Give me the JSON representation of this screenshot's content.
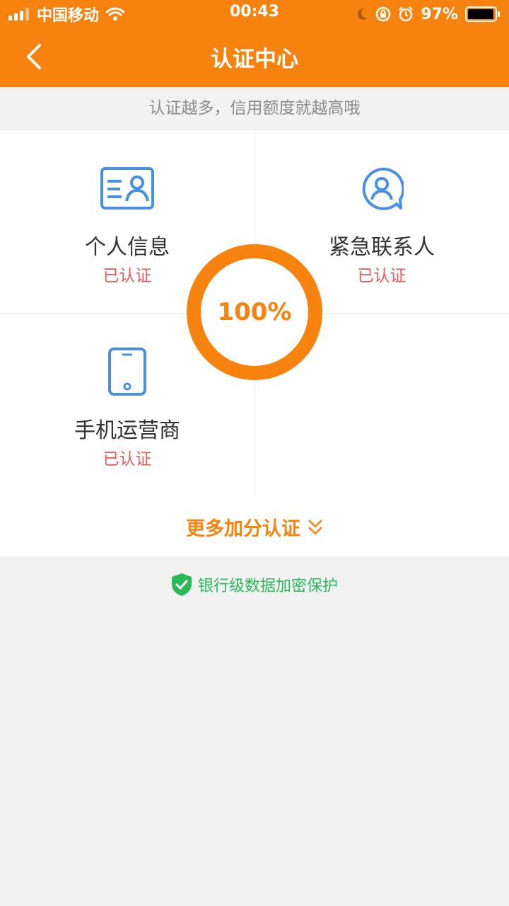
{
  "status_bar": {
    "carrier": "中国移动",
    "time": "00:43",
    "battery_percent": "97%",
    "battery_level": 0.97
  },
  "nav": {
    "title": "认证中心",
    "back_icon": "chevron-left-icon"
  },
  "tagline": "认证越多，信用额度就越高哦",
  "progress": {
    "label": "100%",
    "value": 1.0,
    "color": "#f7820d"
  },
  "items": [
    {
      "title": "个人信息",
      "status": "已认证",
      "icon": "id-card-icon"
    },
    {
      "title": "紧急联系人",
      "status": "已认证",
      "icon": "contact-chat-icon"
    },
    {
      "title": "手机运营商",
      "status": "已认证",
      "icon": "mobile-phone-icon"
    }
  ],
  "more_link": {
    "label": "更多加分认证",
    "icon": "double-chevron-down-icon"
  },
  "security_note": {
    "text": "银行级数据加密保护",
    "icon": "shield-check-icon",
    "color": "#2bb95a"
  },
  "colors": {
    "accent": "#f7820d",
    "icon_blue": "#4a90e2",
    "verified_red": "#e8595c"
  }
}
